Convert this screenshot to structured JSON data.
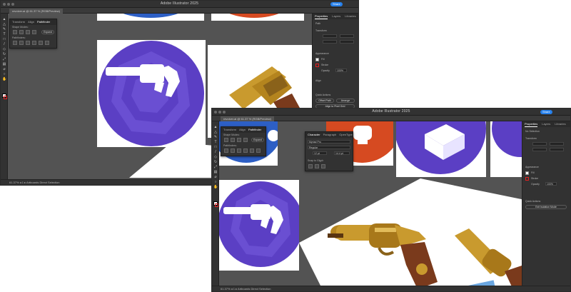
{
  "back_window": {
    "title": "Adobe Illustrator 2025",
    "share_label": "Share",
    "document_tab": "revolver.ai @ 61.37 % (RGB/Preview)",
    "status_text": "61.37%   ◂ 1 ▸   Artboards   Direct Selection",
    "properties_tabs": [
      "Properties",
      "Layers",
      "Libraries"
    ],
    "properties": {
      "section_type": "Path",
      "transform_label": "Transform",
      "appearance_label": "Appearance",
      "fill_label": "Fill",
      "stroke_label": "Stroke",
      "opacity_label": "Opacity",
      "opacity_value": "100%",
      "align_label": "Align",
      "quick_actions_label": "Quick Actions",
      "offset_path_label": "Offset Path",
      "rearrange_label": "Arrange",
      "align_pixel_label": "Align to Pixel Grid"
    },
    "float_panel_tabs": [
      "Transform",
      "Align",
      "Pathfinder"
    ],
    "float_panel": {
      "shape_modes_label": "Shape Modes:",
      "pathfinders_label": "Pathfinders:",
      "expand_label": "Expand"
    }
  },
  "front_window": {
    "title": "Adobe Illustrator 2025",
    "share_label": "Share",
    "document_tab": "revolver.ai @ 61.37 % (RGB/Preview)",
    "status_text": "61.37%   ◂ 1 ▸   Artboards   Direct Selection",
    "properties_tabs": [
      "Properties",
      "Layers",
      "Libraries"
    ],
    "properties": {
      "section_type": "No Selection",
      "transform_label": "Transform",
      "appearance_label": "Appearance",
      "fill_label": "Fill",
      "stroke_label": "Stroke",
      "opacity_label": "Opacity",
      "opacity_value": "100%",
      "quick_actions_label": "Quick Actions",
      "document_setup_label": "Document Setup",
      "preferences_label": "Preferences",
      "exit_label": "Exit Isolation Mode"
    },
    "float_panel_tabs": [
      "Transform",
      "Align",
      "Pathfinder"
    ],
    "float_panel": {
      "shape_modes_label": "Shape Modes:",
      "pathfinders_label": "Pathfinders:",
      "expand_label": "Expand"
    },
    "character_panel_tabs": [
      "Character",
      "Paragraph",
      "OpenType"
    ],
    "character_panel": {
      "font_family": "Myriad Pro",
      "font_style": "Regular",
      "font_size": "12 pt",
      "leading": "14.4 pt",
      "snap_label": "Snap to Glyph"
    }
  },
  "colors": {
    "workspace": "#535353",
    "panel": "#323232",
    "accent_blue": "#2680eb",
    "purple_circle": "#5b3fc4",
    "red_circle": "#d64a21",
    "blue_circle": "#2d5fc5",
    "gold": "#c99a2e"
  },
  "icons": [
    "selection-tool-icon",
    "direct-selection-icon",
    "pen-tool-icon",
    "type-tool-icon",
    "shape-tool-icon",
    "brush-icon",
    "eraser-icon",
    "rotate-icon",
    "scale-icon",
    "gradient-icon",
    "eyedropper-icon",
    "zoom-icon",
    "hand-icon",
    "fill-stroke-icon",
    "revolver-icon",
    "gear-icon"
  ]
}
